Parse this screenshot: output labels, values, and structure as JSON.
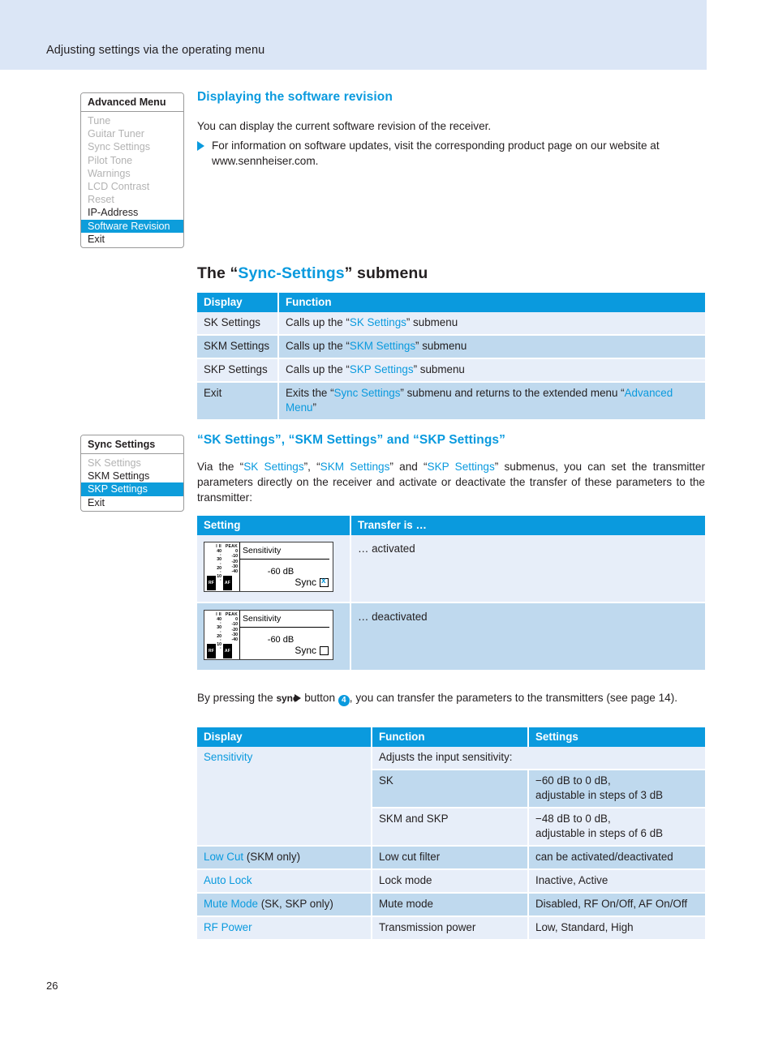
{
  "page": {
    "header_title": "Adjusting settings via the operating menu",
    "page_number": "26",
    "accent": "#0a9ade",
    "band_bg": "#dbe6f6"
  },
  "advanced_menu_box": {
    "title": "Advanced Menu",
    "items": [
      {
        "label": "Tune",
        "state": "dim"
      },
      {
        "label": "Guitar Tuner",
        "state": "dim"
      },
      {
        "label": "Sync Settings",
        "state": "dim"
      },
      {
        "label": "Pilot Tone",
        "state": "dim"
      },
      {
        "label": "Warnings",
        "state": "dim"
      },
      {
        "label": "LCD Contrast",
        "state": "dim"
      },
      {
        "label": "Reset",
        "state": "dim"
      },
      {
        "label": "IP-Address",
        "state": "normal"
      },
      {
        "label": "Software Revision",
        "state": "selected"
      },
      {
        "label": "Exit",
        "state": "normal"
      }
    ]
  },
  "section_software_revision": {
    "heading": "Displaying the software revision",
    "intro": "You can display the current software revision of the receiver.",
    "bullet": "For information on software updates, visit the corresponding product page on our website at www.sennheiser.com."
  },
  "section_sync_settings": {
    "heading_pre": "The “",
    "heading_blue": "Sync-Settings",
    "heading_post": "” submenu",
    "table": {
      "headers": [
        "Display",
        "Function"
      ],
      "rows": [
        {
          "display": "SK Settings",
          "fn_parts": [
            {
              "t": "Calls up the “",
              "c": "black"
            },
            {
              "t": "SK Settings",
              "c": "blue"
            },
            {
              "t": "” submenu",
              "c": "black"
            }
          ]
        },
        {
          "display": "SKM Settings",
          "fn_parts": [
            {
              "t": "Calls up the “",
              "c": "black"
            },
            {
              "t": "SKM Settings",
              "c": "blue"
            },
            {
              "t": "” submenu",
              "c": "black"
            }
          ]
        },
        {
          "display": "SKP Settings",
          "fn_parts": [
            {
              "t": "Calls up the “",
              "c": "black"
            },
            {
              "t": "SKP Settings",
              "c": "blue"
            },
            {
              "t": "” submenu",
              "c": "black"
            }
          ]
        },
        {
          "display": "Exit",
          "fn_parts": [
            {
              "t": "Exits the “",
              "c": "black"
            },
            {
              "t": "Sync Settings",
              "c": "blue"
            },
            {
              "t": "” submenu and returns to the extended menu “",
              "c": "black"
            },
            {
              "t": "Advanced Menu",
              "c": "blue"
            },
            {
              "t": "”",
              "c": "black"
            }
          ]
        }
      ]
    }
  },
  "sync_settings_box": {
    "title": "Sync Settings",
    "items": [
      {
        "label": "SK Settings",
        "state": "dim"
      },
      {
        "label": "SKM Settings",
        "state": "normal"
      },
      {
        "label": "SKP Settings",
        "state": "selected"
      },
      {
        "label": "Exit",
        "state": "normal"
      }
    ]
  },
  "section_sk_skm_skp": {
    "heading": "“SK Settings”, “SKM Settings” and “SKP Settings”",
    "paragraph_parts": [
      {
        "t": "Via the “",
        "c": "black"
      },
      {
        "t": "SK Settings",
        "c": "blue"
      },
      {
        "t": "”, “",
        "c": "black"
      },
      {
        "t": "SKM Settings",
        "c": "blue"
      },
      {
        "t": "” and “",
        "c": "black"
      },
      {
        "t": "SKP Settings",
        "c": "blue"
      },
      {
        "t": "” submenus, you can set the transmitter parameters directly on the receiver and activate or deactivate the transfer of these parameters to the transmitter:",
        "c": "black"
      }
    ],
    "transfer_table": {
      "headers": [
        "Setting",
        "Transfer is …"
      ],
      "rows": [
        {
          "transfer": "… activated",
          "sync_checked": true
        },
        {
          "transfer": "… deactivated",
          "sync_checked": false
        }
      ]
    },
    "lcd": {
      "label": "Sensitivity",
      "value": "-60 dB",
      "sync_label": "Sync",
      "rf_scale": [
        "I II",
        "40",
        "·",
        "30",
        "·",
        "20",
        "·",
        "10",
        "·"
      ],
      "af_scale": [
        "PEAK",
        "0",
        "-10",
        "-20",
        "-30",
        "-40"
      ],
      "rf_tag": "RF",
      "af_tag": "AF"
    },
    "sync_paragraph": {
      "before": "By pressing the",
      "sync_word": "sync",
      "middle": "button",
      "badge": "4",
      "after": ", you can transfer the parameters to the transmitters (see page 14)."
    },
    "params_table": {
      "headers": [
        "Display",
        "Function",
        "Settings"
      ],
      "rows": [
        {
          "display_blue": "Sensitivity",
          "display_plain": "",
          "function": "Adjusts the input sensitivity:",
          "settings": "",
          "span_kind": "head"
        },
        {
          "function": "SK",
          "settings": "−60 dB to 0 dB,\nadjustable in steps of 3 dB",
          "span_kind": "sub"
        },
        {
          "function": "SKM and SKP",
          "settings": "−48 dB to 0 dB,\nadjustable in steps of 6 dB",
          "span_kind": "sub"
        },
        {
          "display_blue": "Low Cut",
          "display_plain": " (SKM only)",
          "function": "Low cut filter",
          "settings": "can be activated/deactivated",
          "span_kind": "row"
        },
        {
          "display_blue": "Auto Lock",
          "display_plain": "",
          "function": "Lock mode",
          "settings": "Inactive, Active",
          "span_kind": "row"
        },
        {
          "display_blue": "Mute Mode",
          "display_plain": " (SK, SKP only)",
          "function": "Mute mode",
          "settings": "Disabled, RF On/Off, AF On/Off",
          "span_kind": "row"
        },
        {
          "display_blue": "RF Power",
          "display_plain": "",
          "function": "Transmission power",
          "settings": "Low, Standard, High",
          "span_kind": "row"
        }
      ]
    }
  }
}
